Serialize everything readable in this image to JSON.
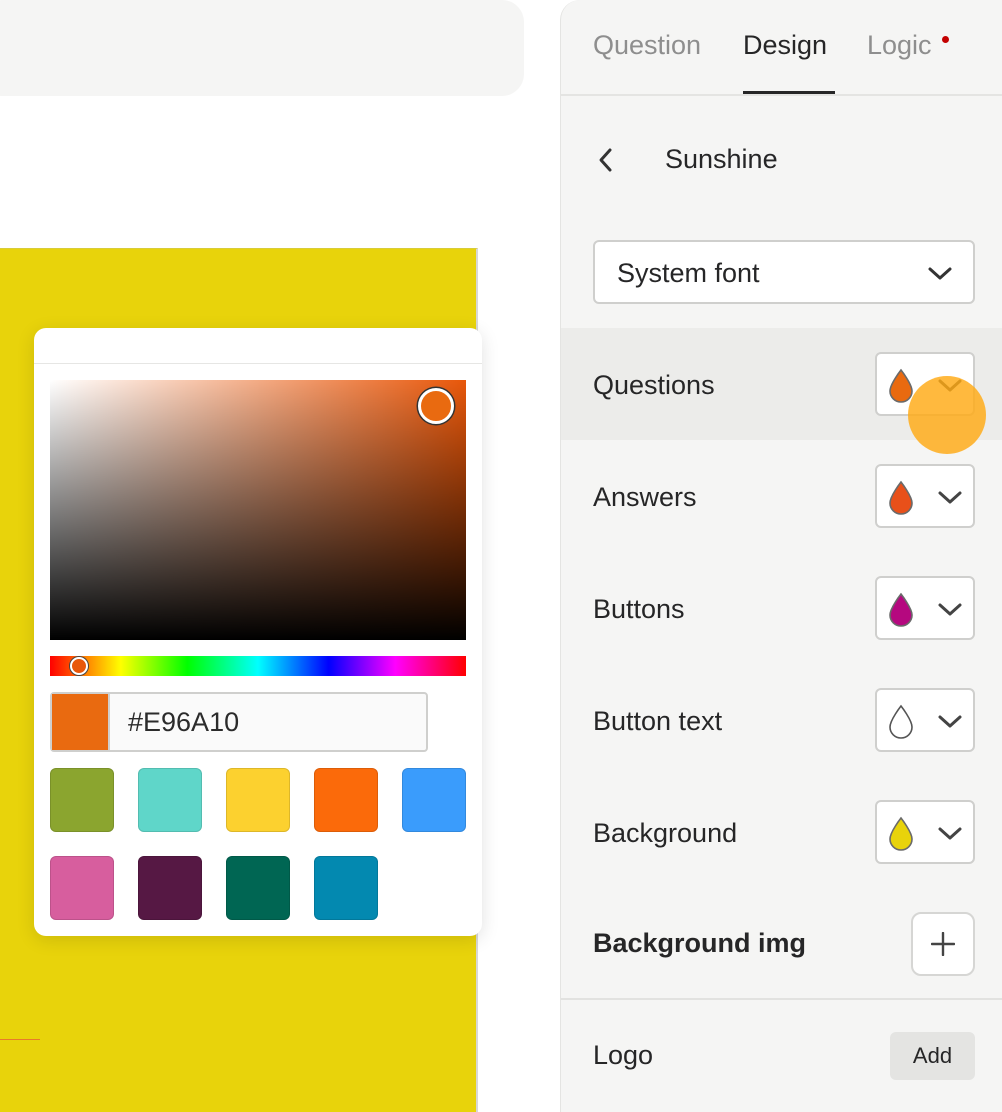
{
  "tabs": [
    {
      "label": "Question",
      "active": false
    },
    {
      "label": "Design",
      "active": true
    },
    {
      "label": "Logic",
      "active": false,
      "has_notification_dot": true
    }
  ],
  "theme": {
    "name": "Sunshine",
    "back_icon": "chevron-left-icon"
  },
  "font_select": {
    "value": "System font",
    "icon": "chevron-down-icon"
  },
  "color_rows": [
    {
      "label": "Questions",
      "color": "#E96A10",
      "icon": "drop-icon"
    },
    {
      "label": "Answers",
      "color": "#E8501A",
      "icon": "drop-icon"
    },
    {
      "label": "Buttons",
      "color": "#B5087F",
      "icon": "drop-icon"
    },
    {
      "label": "Button text",
      "color": "#FFFFFF",
      "icon": "drop-icon"
    },
    {
      "label": "Background",
      "color": "#E8D30B",
      "icon": "drop-icon"
    }
  ],
  "background_img": {
    "label": "Background img",
    "button_icon": "plus-icon"
  },
  "logo": {
    "label": "Logo",
    "button_label": "Add"
  },
  "picker": {
    "hue_color": "#E8570A",
    "hex_value": "#E96A10",
    "swatches": [
      "#8BA52F",
      "#5FD6C9",
      "#FCD12F",
      "#FB6A0A",
      "#3A9CFC",
      "#D75E9E",
      "#561844",
      "#006653",
      "#0389B0"
    ]
  },
  "canvas_background": "#E8D30B"
}
